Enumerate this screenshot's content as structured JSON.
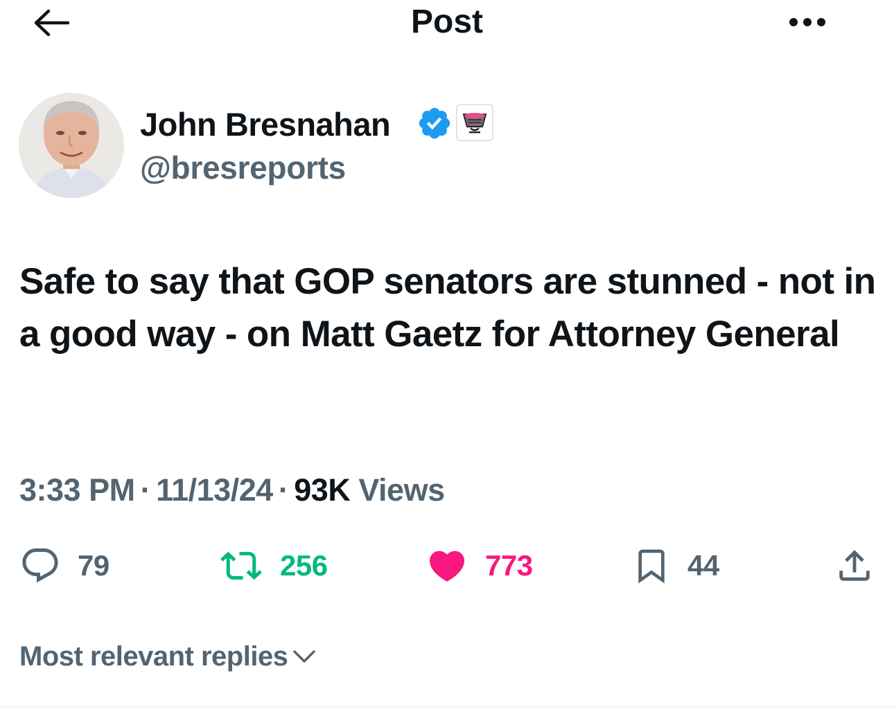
{
  "header": {
    "title": "Post",
    "back_icon": "arrow-left-icon",
    "more_icon": "more-horizontal-icon"
  },
  "author": {
    "name": "John Bresnahan",
    "handle": "@bresreports",
    "verified_icon": "verified-badge-icon",
    "affiliate_icon": "affiliate-badge-icon"
  },
  "post": {
    "text": "Safe to say that GOP senators are stunned - not in a good way - on Matt Gaetz for Attorney General",
    "time": "3:33 PM",
    "date": "11/13/24",
    "separator": "·",
    "views_count": "93K",
    "views_label": "Views"
  },
  "actions": {
    "replies": "79",
    "reposts": "256",
    "likes": "773",
    "bookmarks": "44"
  },
  "replies_sort": {
    "label": "Most relevant replies"
  },
  "colors": {
    "text": "#0f1419",
    "secondary": "#536471",
    "verified": "#1d9bf0",
    "repost": "#00ba7c",
    "like": "#f91880"
  }
}
